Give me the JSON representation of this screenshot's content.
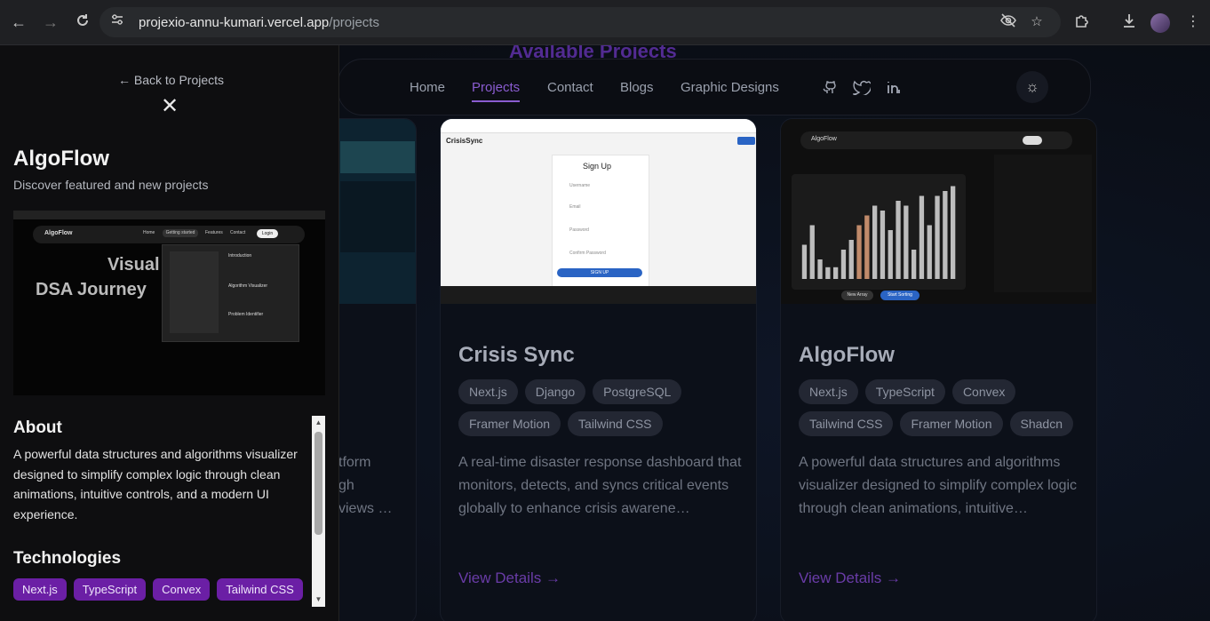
{
  "browser": {
    "url_host": "projexio-annu-kumari.vercel.app",
    "url_path": "/projects",
    "icons": [
      "back-arrow-icon",
      "forward-arrow-icon",
      "reload-icon",
      "site-settings-icon",
      "eye-off-icon",
      "star-icon",
      "extensions-icon",
      "download-icon",
      "profile-avatar",
      "menu-dots-icon"
    ]
  },
  "page": {
    "heading": "Available Projects",
    "nav": [
      "Home",
      "Projects",
      "Contact",
      "Blogs",
      "Graphic Designs"
    ],
    "active_nav": "Projects"
  },
  "cards": [
    {
      "title": "Crisis Sync",
      "tags": [
        "Next.js",
        "Django",
        "PostgreSQL",
        "Framer Motion",
        "Tailwind CSS"
      ],
      "description": "A real-time disaster response dashboard that monitors, detects, and syncs critical events globally to enhance crisis awarene…",
      "link": "View Details →"
    },
    {
      "title": "AlgoFlow",
      "tags": [
        "Next.js",
        "TypeScript",
        "Convex",
        "Tailwind CSS",
        "Framer Motion",
        "Shadcn"
      ],
      "description": "A powerful data structures and algorithms visualizer designed to simplify complex logic through clean animations, intuitive…",
      "link": "View Details →"
    }
  ],
  "partial_card": {
    "desc_lines": [
      "tform",
      "gh",
      "views …"
    ]
  },
  "drawer": {
    "back": "← Back to Projects",
    "title": "AlgoFlow",
    "subtitle": "Discover featured and new projects",
    "about_heading": "About",
    "about_text": "A powerful data structures and algorithms visualizer designed to simplify complex logic through clean animations, intuitive controls, and a modern UI experience.",
    "tech_heading": "Technologies",
    "tech": [
      "Next.js",
      "TypeScript",
      "Convex",
      "Tailwind CSS"
    ]
  },
  "screens": {
    "crisis": {
      "brand": "CrisisSync",
      "form_title": "Sign Up",
      "fields": [
        "Username",
        "Email",
        "Password",
        "Confirm Password"
      ],
      "button": "SIGN UP"
    },
    "algoflow": {
      "brand": "AlgoFlow",
      "nav": [
        "Home",
        "Getting started",
        "Features",
        "Contact"
      ],
      "login": "Login",
      "buttons": [
        "New Array",
        "Start Sorting"
      ],
      "bars": [
        0.35,
        0.55,
        0.2,
        0.12,
        0.12,
        0.3,
        0.4,
        0.55,
        0.65,
        0.75,
        0.7,
        0.5,
        0.8,
        0.75,
        0.3,
        0.85,
        0.55,
        0.85,
        0.9,
        0.95
      ],
      "highlight": [
        7,
        8
      ],
      "hero": [
        "Visual",
        "DSA Journey"
      ],
      "menu": [
        "Introduction",
        "Algorithm Visualizer",
        "Problem Identifier"
      ]
    }
  }
}
